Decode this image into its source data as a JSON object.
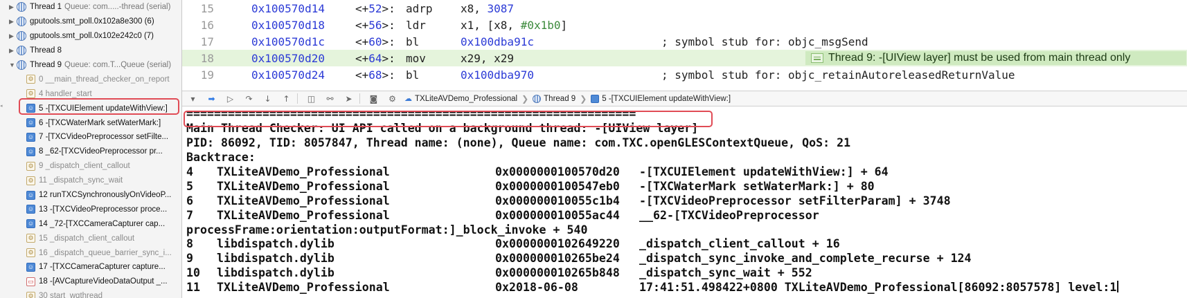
{
  "sidebar": {
    "threads_top": [
      {
        "title": "Thread 1",
        "queue": "Queue: com.....-thread (serial)"
      },
      {
        "title": "gputools.smt_poll.0x102a8e300 (6)",
        "queue": ""
      },
      {
        "title": "gputools.smt_poll.0x102e242c0 (7)",
        "queue": ""
      },
      {
        "title": "Thread 8",
        "queue": ""
      }
    ],
    "current_thread": {
      "title": "Thread 9",
      "queue": "Queue: com.T...Queue (serial)"
    },
    "frames": [
      {
        "label": "0 __main_thread_checker_on_report",
        "kind": "system"
      },
      {
        "label": "4 handler_start",
        "kind": "system"
      },
      {
        "label": "5 -[TXCUIElement updateWithView:]",
        "kind": "user"
      },
      {
        "label": "6 -[TXCWaterMark setWaterMark:]",
        "kind": "user"
      },
      {
        "label": "7 -[TXCVideoPreprocessor setFilte...",
        "kind": "user"
      },
      {
        "label": "8 _62-[TXCVideoPreprocessor pr...",
        "kind": "user"
      },
      {
        "label": "9 _dispatch_client_callout",
        "kind": "system"
      },
      {
        "label": "11 _dispatch_sync_wait",
        "kind": "system"
      },
      {
        "label": "12 runTXCSynchronouslyOnVideoP...",
        "kind": "user"
      },
      {
        "label": "13 -[TXCVideoPreprocessor proce...",
        "kind": "user"
      },
      {
        "label": "14 _72-[TXCCameraCapturer cap...",
        "kind": "user"
      },
      {
        "label": "15 _dispatch_client_callout",
        "kind": "system"
      },
      {
        "label": "16 _dispatch_queue_barrier_sync_i...",
        "kind": "system"
      },
      {
        "label": "17 -[TXCCameraCapturer capture...",
        "kind": "user"
      },
      {
        "label": "18 -[AVCaptureVideoDataOutput _...",
        "kind": "capture"
      },
      {
        "label": "30 start_wqthread",
        "kind": "system"
      }
    ]
  },
  "editor": {
    "lines": [
      {
        "ln": "15",
        "addr": "0x100570d14",
        "off_pre": "<+",
        "off_num": "52",
        "off_post": ">:",
        "mnemonic": "adrp",
        "op_a": "x8, ",
        "op_num": "3087",
        "op_imm": "",
        "op_tail": "",
        "comment": ""
      },
      {
        "ln": "16",
        "addr": "0x100570d18",
        "off_pre": "<+",
        "off_num": "56",
        "off_post": ">:",
        "mnemonic": "ldr",
        "op_a": "x1, [x8, ",
        "op_num": "",
        "op_imm": "#0x1b0",
        "op_tail": "]",
        "comment": ""
      },
      {
        "ln": "17",
        "addr": "0x100570d1c",
        "off_pre": "<+",
        "off_num": "60",
        "off_post": ">:",
        "mnemonic": "bl",
        "op_a": "",
        "op_num": "0x100dba91c",
        "op_imm": "",
        "op_tail": "",
        "comment": "; symbol stub for: objc_msgSend"
      },
      {
        "ln": "18",
        "addr": "0x100570d20",
        "off_pre": "<+",
        "off_num": "64",
        "off_post": ">:",
        "mnemonic": "mov",
        "op_a": "x29, x29",
        "op_num": "",
        "op_imm": "",
        "op_tail": "",
        "comment": ""
      },
      {
        "ln": "19",
        "addr": "0x100570d24",
        "off_pre": "<+",
        "off_num": "68",
        "off_post": ">:",
        "mnemonic": "bl",
        "op_a": "",
        "op_num": "0x100dba970",
        "op_imm": "",
        "op_tail": "",
        "comment": "; symbol stub for: objc_retainAutoreleasedReturnValue"
      }
    ],
    "warning": "Thread 9: -[UIView layer] must be used from main thread only"
  },
  "debugbar": {
    "crumbs": {
      "app": "TXLiteAVDemo_Professional",
      "thread": "Thread 9",
      "frame": "5 -[TXCUIElement updateWithView:]"
    }
  },
  "console": {
    "separator": "=================================================================",
    "headline": "Main Thread Checker: UI API called on a background thread: -[UIView layer]",
    "info": "PID: 86092, TID: 8057847, Thread name: (none), Queue name: com.TXC.openGLESContextQueue, QoS: 21",
    "backtrace_label": "Backtrace:",
    "backtrace": [
      {
        "idx": "4",
        "lib": "TXLiteAVDemo_Professional",
        "addr": "0x0000000100570d20",
        "sym": "-[TXCUIElement updateWithView:] + 64"
      },
      {
        "idx": "5",
        "lib": "TXLiteAVDemo_Professional",
        "addr": "0x0000000100547eb0",
        "sym": "-[TXCWaterMark setWaterMark:] + 80"
      },
      {
        "idx": "6",
        "lib": "TXLiteAVDemo_Professional",
        "addr": "0x000000010055c1b4",
        "sym": "-[TXCVideoPreprocessor setFilterParam] + 3748"
      },
      {
        "idx": "7",
        "lib": "TXLiteAVDemo_Professional",
        "addr": "0x000000010055ac44",
        "sym": "__62-[TXCVideoPreprocessor"
      }
    ],
    "continuation": "processFrame:orientation:outputFormat:]_block_invoke + 540",
    "backtrace2": [
      {
        "idx": "8",
        "lib": "libdispatch.dylib",
        "addr": "0x0000000102649220",
        "sym": "_dispatch_client_callout + 16"
      },
      {
        "idx": "9",
        "lib": "libdispatch.dylib",
        "addr": "0x000000010265be24",
        "sym": "_dispatch_sync_invoke_and_complete_recurse + 124"
      },
      {
        "idx": "10",
        "lib": "libdispatch.dylib",
        "addr": "0x000000010265b848",
        "sym": "_dispatch_sync_wait + 552"
      },
      {
        "idx": "11",
        "lib": "TXLiteAVDemo_Professional",
        "addr": "0x2018-06-08",
        "sym": "17:41:51.498422+0800 TXLiteAVDemo_Professional[86092:8057578] level:1"
      }
    ]
  }
}
